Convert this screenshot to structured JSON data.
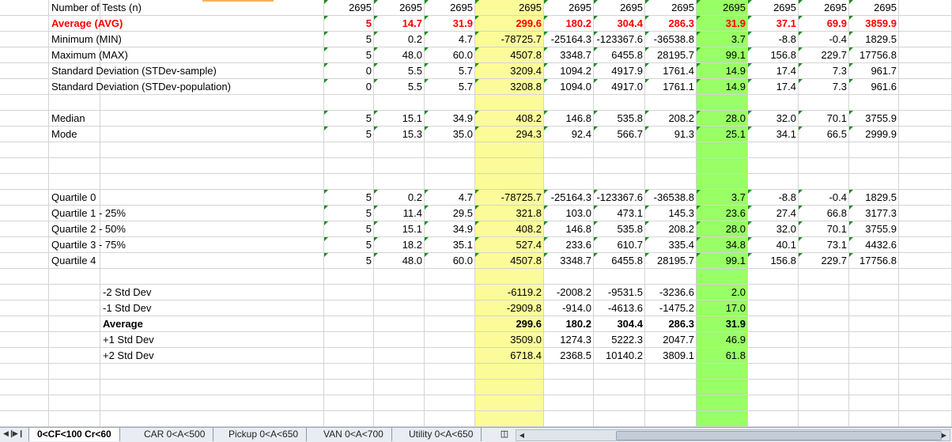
{
  "rows": [
    {
      "label": "Number of Tests (n)",
      "labelClass": "",
      "vals": [
        "2695",
        "2695",
        "2695",
        "2695",
        "2695",
        "2695",
        "2695",
        "2695",
        "2695",
        "2695",
        "2695"
      ],
      "valClass": "",
      "tri": true
    },
    {
      "label": "Average (AVG)",
      "labelClass": "red",
      "vals": [
        "5",
        "14.7",
        "31.9",
        "299.6",
        "180.2",
        "304.4",
        "286.3",
        "31.9",
        "37.1",
        "69.9",
        "3859.9"
      ],
      "valClass": "red",
      "tri": true
    },
    {
      "label": "Minimum (MIN)",
      "labelClass": "",
      "vals": [
        "5",
        "0.2",
        "4.7",
        "-78725.7",
        "-25164.3",
        "-123367.6",
        "-36538.8",
        "3.7",
        "-8.8",
        "-0.4",
        "1829.5"
      ],
      "valClass": "",
      "tri": true
    },
    {
      "label": "Maximum (MAX)",
      "labelClass": "",
      "vals": [
        "5",
        "48.0",
        "60.0",
        "4507.8",
        "3348.7",
        "6455.8",
        "28195.7",
        "99.1",
        "156.8",
        "229.7",
        "17756.8"
      ],
      "valClass": "",
      "tri": true
    },
    {
      "label": "Standard Deviation (STDev-sample)",
      "labelClass": "",
      "vals": [
        "0",
        "5.5",
        "5.7",
        "3209.4",
        "1094.2",
        "4917.9",
        "1761.4",
        "14.9",
        "17.4",
        "7.3",
        "961.7"
      ],
      "valClass": "",
      "tri": true
    },
    {
      "label": "Standard Deviation (STDev-population)",
      "labelClass": "",
      "vals": [
        "0",
        "5.5",
        "5.7",
        "3208.8",
        "1094.0",
        "4917.0",
        "1761.1",
        "14.9",
        "17.4",
        "7.3",
        "961.6"
      ],
      "valClass": "",
      "tri": true
    },
    {
      "label": "",
      "labelClass": "",
      "vals": [
        "",
        "",
        "",
        "",
        "",
        "",
        "",
        "",
        "",
        "",
        ""
      ],
      "valClass": "",
      "tri": false
    },
    {
      "label": "Median",
      "labelClass": "",
      "vals": [
        "5",
        "15.1",
        "34.9",
        "408.2",
        "146.8",
        "535.8",
        "208.2",
        "28.0",
        "32.0",
        "70.1",
        "3755.9"
      ],
      "valClass": "",
      "tri": true
    },
    {
      "label": "Mode",
      "labelClass": "",
      "vals": [
        "5",
        "15.3",
        "35.0",
        "294.3",
        "92.4",
        "566.7",
        "91.3",
        "25.1",
        "34.1",
        "66.5",
        "2999.9"
      ],
      "valClass": "",
      "tri": true
    },
    {
      "label": "",
      "labelClass": "",
      "vals": [
        "",
        "",
        "",
        "",
        "",
        "",
        "",
        "",
        "",
        "",
        ""
      ],
      "valClass": "",
      "tri": false
    },
    {
      "label": "",
      "labelClass": "",
      "vals": [
        "",
        "",
        "",
        "",
        "",
        "",
        "",
        "",
        "",
        "",
        ""
      ],
      "valClass": "",
      "tri": false
    },
    {
      "label": "",
      "labelClass": "",
      "vals": [
        "",
        "",
        "",
        "",
        "",
        "",
        "",
        "",
        "",
        "",
        ""
      ],
      "valClass": "",
      "tri": false
    },
    {
      "label": "Quartile 0",
      "labelClass": "",
      "vals": [
        "5",
        "0.2",
        "4.7",
        "-78725.7",
        "-25164.3",
        "-123367.6",
        "-36538.8",
        "3.7",
        "-8.8",
        "-0.4",
        "1829.5"
      ],
      "valClass": "",
      "tri": true
    },
    {
      "label": "Quartile 1 - 25%",
      "labelClass": "",
      "vals": [
        "5",
        "11.4",
        "29.5",
        "321.8",
        "103.0",
        "473.1",
        "145.3",
        "23.6",
        "27.4",
        "66.8",
        "3177.3"
      ],
      "valClass": "",
      "tri": true
    },
    {
      "label": "Quartile 2 - 50%",
      "labelClass": "",
      "vals": [
        "5",
        "15.1",
        "34.9",
        "408.2",
        "146.8",
        "535.8",
        "208.2",
        "28.0",
        "32.0",
        "70.1",
        "3755.9"
      ],
      "valClass": "",
      "tri": true
    },
    {
      "label": "Quartile 3 - 75%",
      "labelClass": "",
      "vals": [
        "5",
        "18.2",
        "35.1",
        "527.4",
        "233.6",
        "610.7",
        "335.4",
        "34.8",
        "40.1",
        "73.1",
        "4432.6"
      ],
      "valClass": "",
      "tri": true
    },
    {
      "label": "Quartile 4",
      "labelClass": "",
      "vals": [
        "5",
        "48.0",
        "60.0",
        "4507.8",
        "3348.7",
        "6455.8",
        "28195.7",
        "99.1",
        "156.8",
        "229.7",
        "17756.8"
      ],
      "valClass": "",
      "tri": true
    },
    {
      "label": "",
      "labelClass": "",
      "vals": [
        "",
        "",
        "",
        "",
        "",
        "",
        "",
        "",
        "",
        "",
        ""
      ],
      "valClass": "",
      "tri": false
    },
    {
      "label": "-2 Std Dev",
      "labelClass": "",
      "indent": true,
      "vals": [
        "",
        "",
        "",
        "-6119.2",
        "-2008.2",
        "-9531.5",
        "-3236.6",
        "2.0",
        "",
        "",
        ""
      ],
      "valClass": "",
      "tri": false
    },
    {
      "label": "-1 Std Dev",
      "labelClass": "",
      "indent": true,
      "vals": [
        "",
        "",
        "",
        "-2909.8",
        "-914.0",
        "-4613.6",
        "-1475.2",
        "17.0",
        "",
        "",
        ""
      ],
      "valClass": "",
      "tri": false
    },
    {
      "label": "Average",
      "labelClass": "bold",
      "indent": true,
      "vals": [
        "",
        "",
        "",
        "299.6",
        "180.2",
        "304.4",
        "286.3",
        "31.9",
        "",
        "",
        ""
      ],
      "valClass": "bold",
      "tri": false
    },
    {
      "label": "+1 Std Dev",
      "labelClass": "",
      "indent": true,
      "vals": [
        "",
        "",
        "",
        "3509.0",
        "1274.3",
        "5222.3",
        "2047.7",
        "46.9",
        "",
        "",
        ""
      ],
      "valClass": "",
      "tri": false
    },
    {
      "label": "+2 Std Dev",
      "labelClass": "",
      "indent": true,
      "vals": [
        "",
        "",
        "",
        "6718.4",
        "2368.5",
        "10140.2",
        "3809.1",
        "61.8",
        "",
        "",
        ""
      ],
      "valClass": "",
      "tri": false
    },
    {
      "label": "",
      "labelClass": "",
      "vals": [
        "",
        "",
        "",
        "",
        "",
        "",
        "",
        "",
        "",
        "",
        ""
      ],
      "valClass": "",
      "tri": false
    },
    {
      "label": "",
      "labelClass": "",
      "vals": [
        "",
        "",
        "",
        "",
        "",
        "",
        "",
        "",
        "",
        "",
        ""
      ],
      "valClass": "",
      "tri": false
    },
    {
      "label": "",
      "labelClass": "",
      "vals": [
        "",
        "",
        "",
        "",
        "",
        "",
        "",
        "",
        "",
        "",
        ""
      ],
      "valClass": "",
      "tri": false
    },
    {
      "label": "",
      "labelClass": "",
      "vals": [
        "",
        "",
        "",
        "",
        "",
        "",
        "",
        "",
        "",
        "",
        ""
      ],
      "valClass": "",
      "tri": false
    }
  ],
  "highlight": {
    "yellow_col": 3,
    "green_col": 7,
    "yellow": "#fbfb99",
    "green": "#99ff66"
  },
  "tabs": [
    "0<CF<100 Cr<60",
    "CAR 0<A<500",
    "Pickup 0<A<650",
    "VAN 0<A<700",
    "Utility 0<A<650"
  ],
  "active_tab": 0
}
